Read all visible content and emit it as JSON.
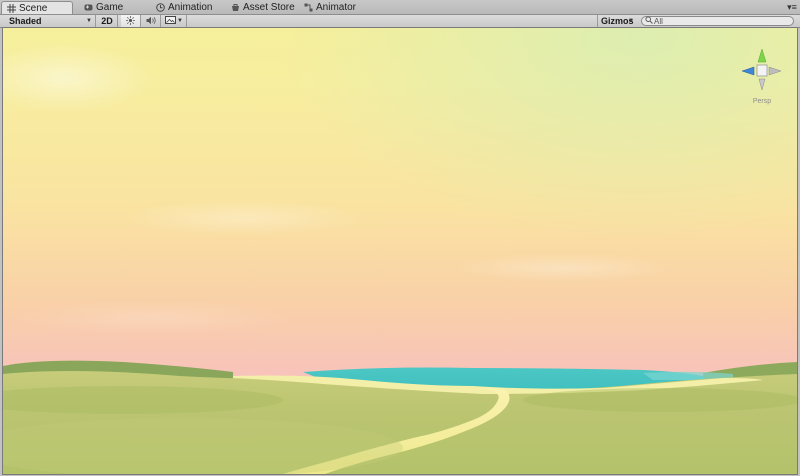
{
  "tabs": [
    {
      "label": "Scene",
      "icon": "grid-icon",
      "active": true
    },
    {
      "label": "Game",
      "icon": "game-icon",
      "active": false
    },
    {
      "label": "Animation",
      "icon": "animation-clock-icon",
      "active": false
    },
    {
      "label": "Asset Store",
      "icon": "asset-store-icon",
      "active": false
    },
    {
      "label": "Animator",
      "icon": "animator-icon",
      "active": false
    }
  ],
  "toolbar": {
    "draw_mode": "Shaded",
    "mode_2d": "2D",
    "lighting_icon": "sun-icon",
    "audio_icon": "speaker-icon",
    "effects_icon": "image-icon",
    "gizmos": "Gizmos",
    "search_value": "All",
    "search_icon": "search-icon"
  },
  "viewport": {
    "projection_label": "Persp",
    "colors": {
      "sky_top": "#f8ef9e",
      "sky_mid": "#f9dfa4",
      "sky_horizon": "#f8c0c0",
      "water": "#42c3c2",
      "grass": "#b7c66d",
      "path": "#f2ef9a"
    }
  }
}
